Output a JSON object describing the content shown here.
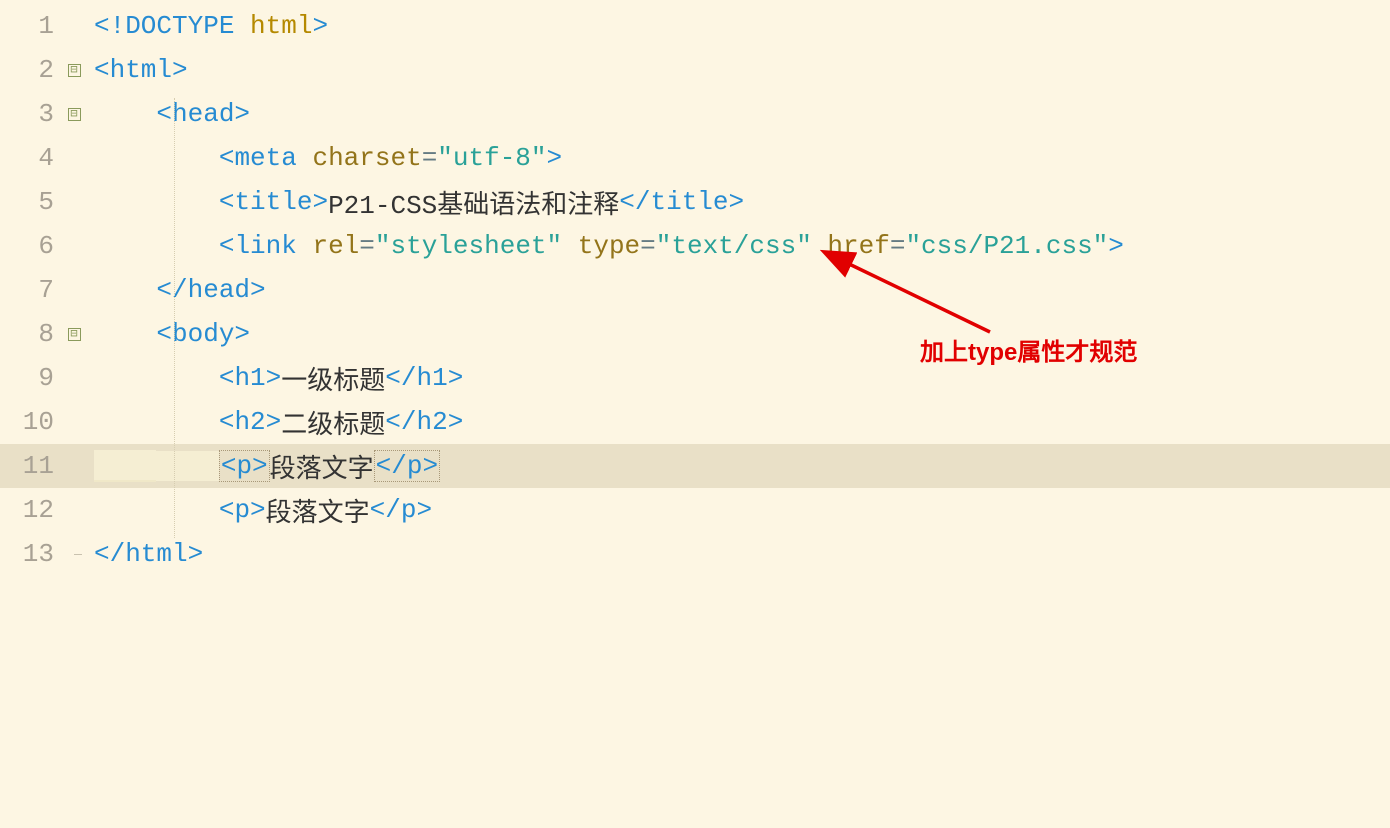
{
  "lines": {
    "1": {
      "num": "1",
      "fold": "",
      "tokens": [
        {
          "t": "tag",
          "v": "<!"
        },
        {
          "t": "tag",
          "v": "DOCTYPE "
        },
        {
          "t": "doctype-kw",
          "v": "html"
        },
        {
          "t": "tag",
          "v": ">"
        }
      ],
      "indent": 0
    },
    "2": {
      "num": "2",
      "fold": "box",
      "tokens": [
        {
          "t": "tag",
          "v": "<html>"
        }
      ],
      "indent": 0
    },
    "3": {
      "num": "3",
      "fold": "box",
      "tokens": [
        {
          "t": "tag",
          "v": "<head>"
        }
      ],
      "indent": 1
    },
    "4": {
      "num": "4",
      "fold": "line",
      "tokens": [
        {
          "t": "tag",
          "v": "<meta "
        },
        {
          "t": "attr",
          "v": "charset"
        },
        {
          "t": "eq",
          "v": "="
        },
        {
          "t": "str",
          "v": "\"utf-8\""
        },
        {
          "t": "tag",
          "v": ">"
        }
      ],
      "indent": 2
    },
    "5": {
      "num": "5",
      "fold": "line",
      "tokens": [
        {
          "t": "tag",
          "v": "<title>"
        },
        {
          "t": "txt",
          "v": "P21-CSS基础语法和注释"
        },
        {
          "t": "tag",
          "v": "</title>"
        }
      ],
      "indent": 2
    },
    "6": {
      "num": "6",
      "fold": "line",
      "tokens": [
        {
          "t": "tag",
          "v": "<link "
        },
        {
          "t": "attr",
          "v": "rel"
        },
        {
          "t": "eq",
          "v": "="
        },
        {
          "t": "str",
          "v": "\"stylesheet\" "
        },
        {
          "t": "attr",
          "v": "type"
        },
        {
          "t": "eq",
          "v": "="
        },
        {
          "t": "str",
          "v": "\"text/css\" "
        },
        {
          "t": "attr",
          "v": "href"
        },
        {
          "t": "eq",
          "v": "="
        },
        {
          "t": "str",
          "v": "\"css/P21.css\""
        },
        {
          "t": "tag",
          "v": ">"
        }
      ],
      "indent": 2
    },
    "7": {
      "num": "7",
      "fold": "line",
      "tokens": [
        {
          "t": "tag",
          "v": "</head>"
        }
      ],
      "indent": 1
    },
    "8": {
      "num": "8",
      "fold": "box",
      "tokens": [
        {
          "t": "tag",
          "v": "<body>"
        }
      ],
      "indent": 1
    },
    "9": {
      "num": "9",
      "fold": "line",
      "tokens": [
        {
          "t": "tag",
          "v": "<h1>"
        },
        {
          "t": "txt",
          "v": "一级标题"
        },
        {
          "t": "tag",
          "v": "</h1>"
        }
      ],
      "indent": 2
    },
    "10": {
      "num": "10",
      "fold": "line",
      "tokens": [
        {
          "t": "tag",
          "v": "<h2>"
        },
        {
          "t": "txt",
          "v": "二级标题"
        },
        {
          "t": "tag",
          "v": "</h2>"
        }
      ],
      "indent": 2
    },
    "11": {
      "num": "11",
      "fold": "line",
      "highlighted": true,
      "tokens": [
        {
          "t": "tag",
          "v": "<p>",
          "box": true
        },
        {
          "t": "txt",
          "v": "段落文字"
        },
        {
          "t": "tag",
          "v": "</p>",
          "box": true
        }
      ],
      "indent": 2
    },
    "12": {
      "num": "12",
      "fold": "line",
      "tokens": [
        {
          "t": "tag",
          "v": "<p>"
        },
        {
          "t": "txt",
          "v": "段落文字"
        },
        {
          "t": "tag",
          "v": "</p>"
        }
      ],
      "indent": 2
    },
    "13": {
      "num": "13",
      "fold": "end",
      "tokens": [
        {
          "t": "tag",
          "v": "</html>"
        }
      ],
      "indent": 0
    }
  },
  "fold_symbol": "⊟",
  "annotation": {
    "text": "加上type属性才规范",
    "arrow_color": "#e10000"
  },
  "indent_unit": "    "
}
